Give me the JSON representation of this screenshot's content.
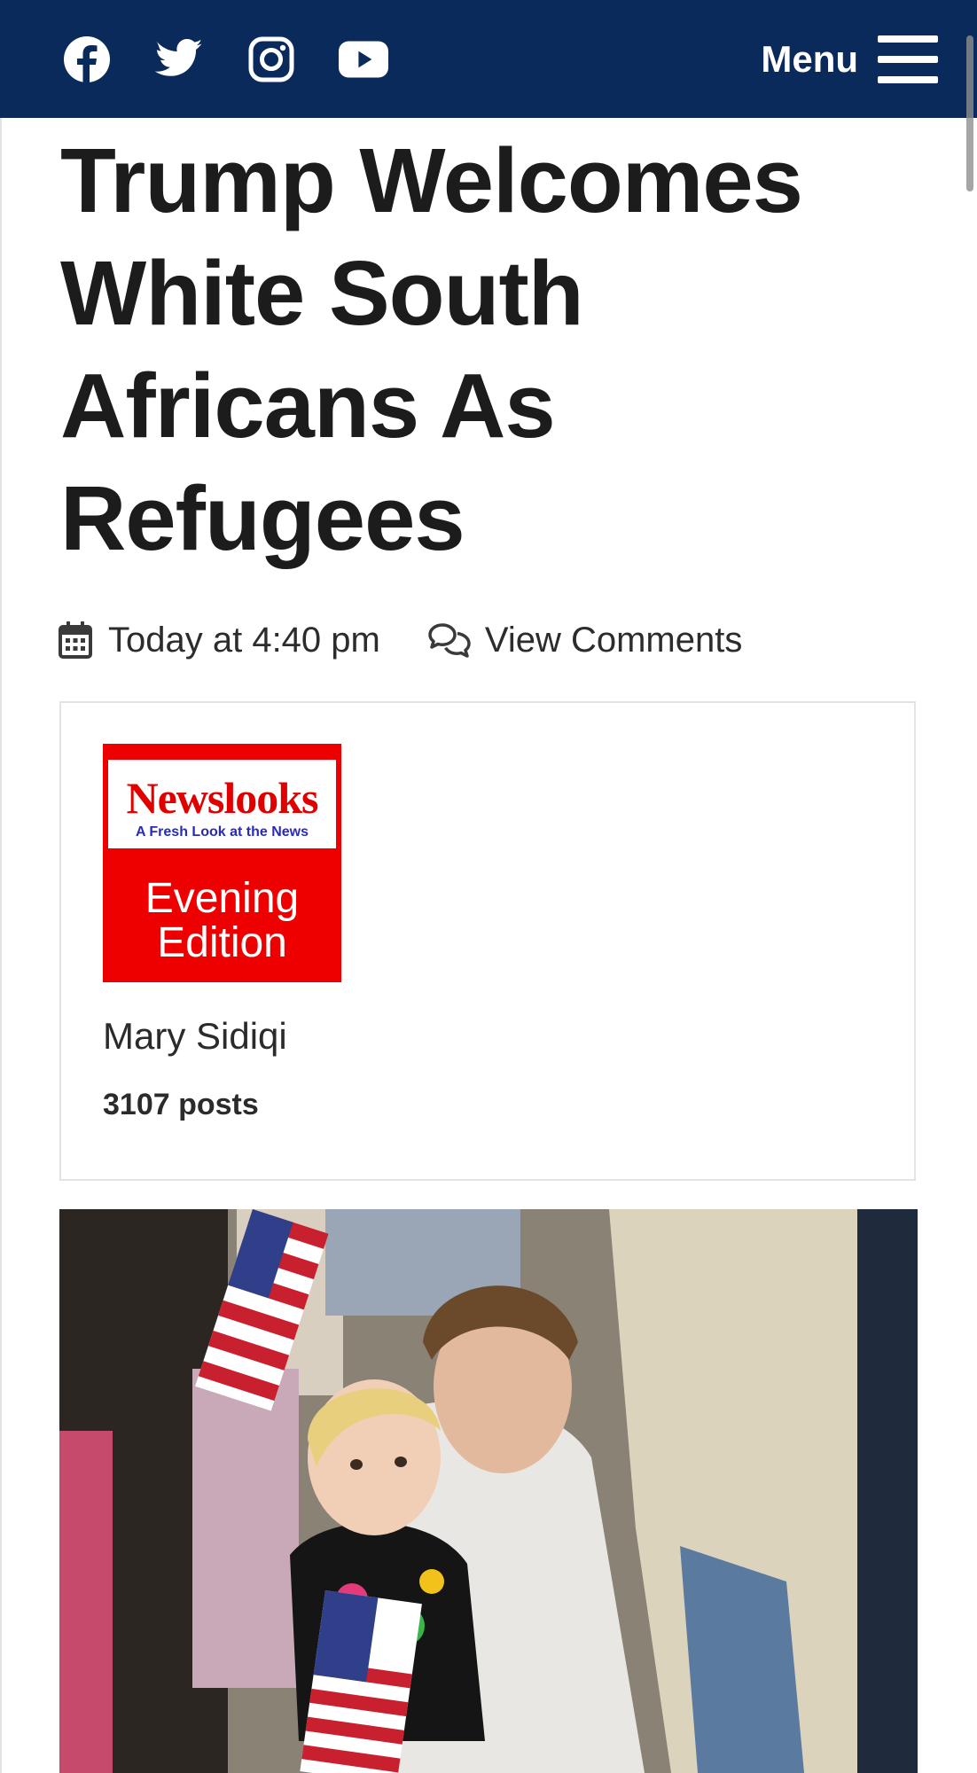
{
  "nav": {
    "social_icons": [
      "facebook-icon",
      "twitter-icon",
      "instagram-icon",
      "youtube-icon"
    ],
    "menu_label": "Menu",
    "background": "#0a2a5c"
  },
  "article": {
    "title": "Trump Welcomes White South Africans As Refugees",
    "date": "Today at 4:40 pm",
    "comments_link": "View Comments"
  },
  "author": {
    "logo_brand": "Newslooks",
    "logo_tagline": "A Fresh Look at the News",
    "logo_edition_line1": "Evening",
    "logo_edition_line2": "Edition",
    "logo_color": "#ee0000",
    "name": "Mary Sidiqi",
    "posts": "3107 posts"
  }
}
